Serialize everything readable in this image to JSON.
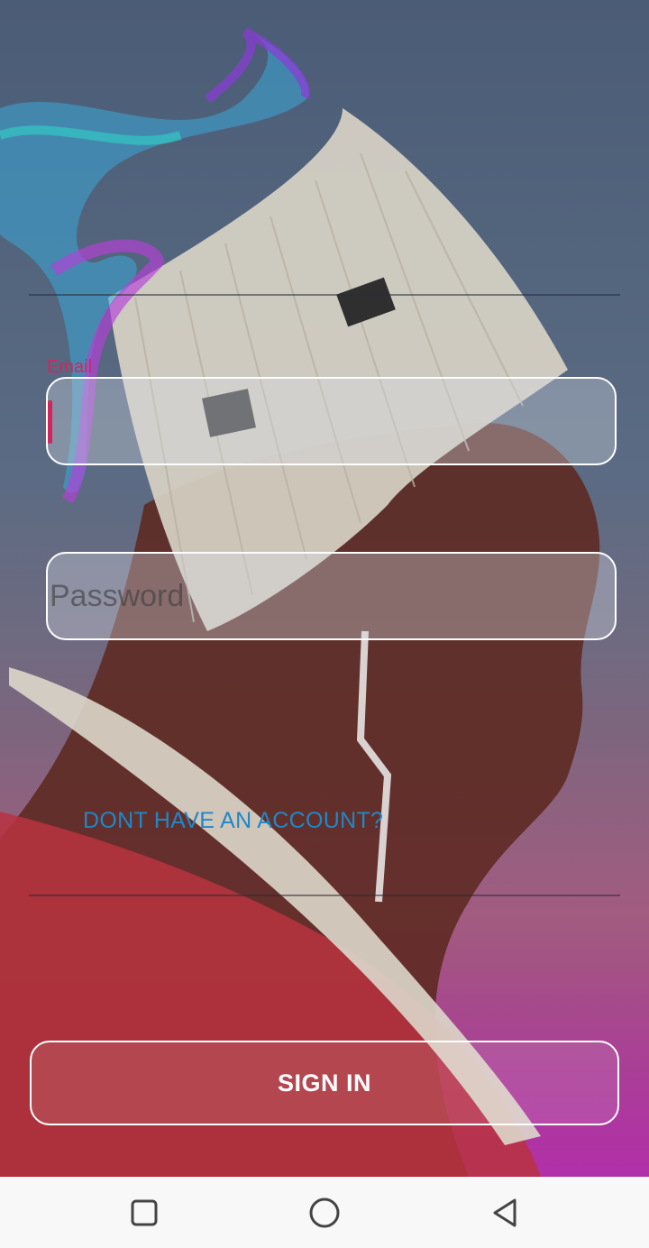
{
  "login": {
    "email_label": "Email",
    "email_value": "",
    "password_placeholder": "Password",
    "signup_link": "DONT HAVE AN ACCOUNT?",
    "signin_button": "SIGN IN"
  },
  "navbar": {
    "icons": [
      "recent-apps-icon",
      "home-icon",
      "back-icon"
    ]
  },
  "colors": {
    "accent": "#d4245f",
    "link": "#1e88c9"
  }
}
